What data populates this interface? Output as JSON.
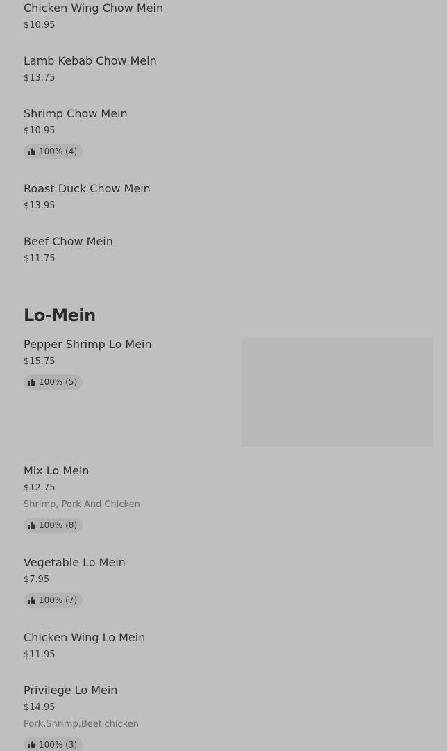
{
  "chow_mein_items": [
    {
      "name": "Chicken Wing Chow Mein",
      "price": "$10.95"
    },
    {
      "name": "Lamb Kebab Chow Mein",
      "price": "$13.75"
    },
    {
      "name": "Shrimp Chow Mein",
      "price": "$10.95",
      "rating": "100% (4)"
    },
    {
      "name": "Roast Duck Chow Mein",
      "price": "$13.95"
    },
    {
      "name": "Beef Chow Mein",
      "price": "$11.75"
    }
  ],
  "lo_mein_section": {
    "title": "Lo-Mein",
    "items": [
      {
        "name": "Pepper Shrimp Lo Mein",
        "price": "$15.75",
        "rating": "100% (5)"
      },
      {
        "name": "Mix Lo Mein",
        "price": "$12.75",
        "description": "Shrimp, Pork And Chicken",
        "rating": "100% (8)"
      },
      {
        "name": "Vegetable Lo Mein",
        "price": "$7.95",
        "rating": "100% (7)"
      },
      {
        "name": "Chicken Wing Lo Mein",
        "price": "$11.95"
      },
      {
        "name": "Privilege Lo Mein",
        "price": "$14.95",
        "description": "Pork,Shrimp,Beef,chicken",
        "rating": "100% (3)"
      }
    ]
  },
  "icons": {
    "rating_icon": "thumbs-up-icon"
  }
}
